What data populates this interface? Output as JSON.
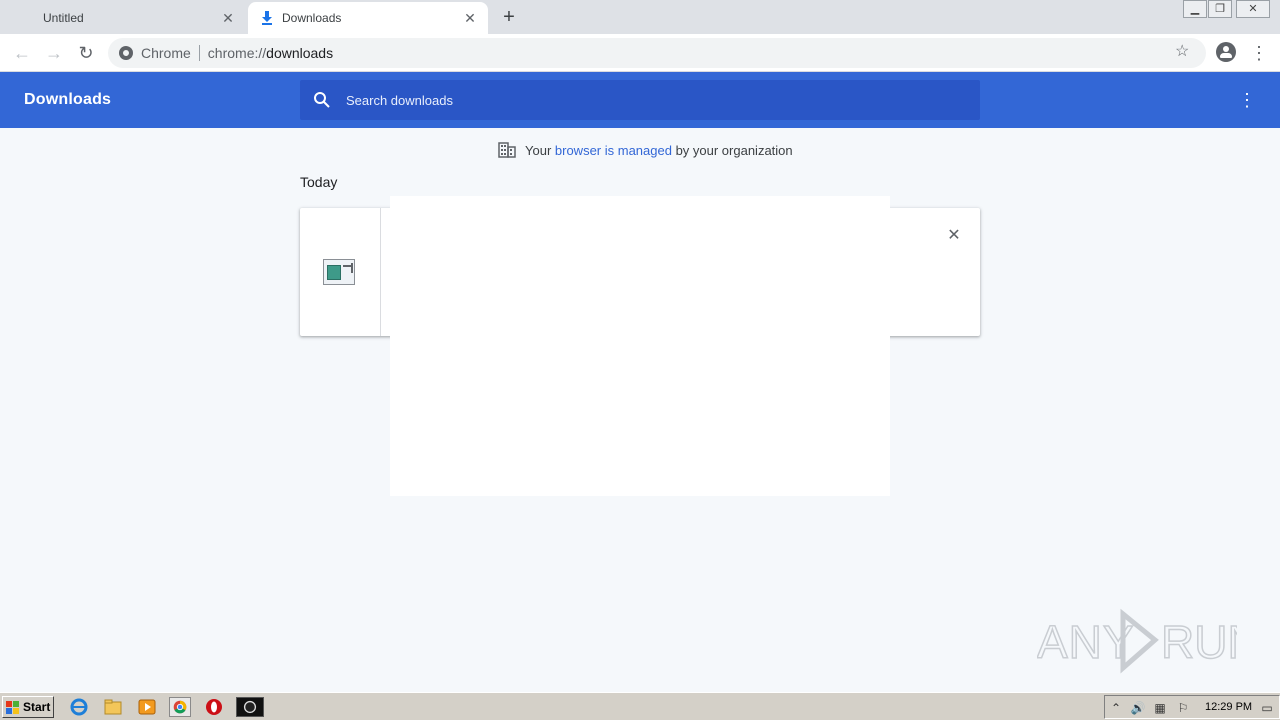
{
  "browser": {
    "tabs": [
      {
        "label": "Untitled",
        "active": false
      },
      {
        "label": "Downloads",
        "active": true
      }
    ],
    "omnibox": {
      "site_chip": "Chrome",
      "url_scheme": "chrome://",
      "url_host": "downloads"
    }
  },
  "downloads_page": {
    "title": "Downloads",
    "search": {
      "placeholder": "Search downloads",
      "value": ""
    },
    "managed_notice": {
      "prefix": "Your ",
      "link_text": "browser is managed",
      "suffix": " by your organization"
    },
    "section_label": "Today"
  },
  "watermark": {
    "text": "ANY RUN"
  },
  "taskbar": {
    "start_label": "Start",
    "clock": "12:29 PM"
  },
  "colors": {
    "header_blue": "#3367d6",
    "search_blue": "#2a56c6",
    "page_bg": "#f5f8fb",
    "link": "#3367d6"
  }
}
